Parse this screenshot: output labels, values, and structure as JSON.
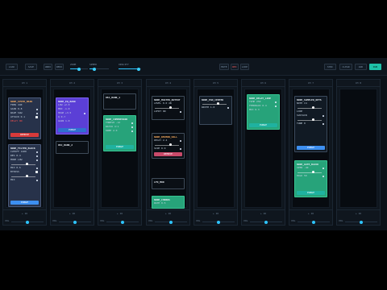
{
  "toolbar": {
    "left_buttons": [
      "LOAD",
      "SAVE",
      "UNDO",
      "REDO"
    ],
    "slider1_label": "ZOOM",
    "slider1_value": 0.5,
    "slider2_label": "SPEED",
    "slider2_value": 0.25,
    "slider3_label": "OPACITY",
    "slider3_value": 0.88,
    "mid_buttons": [
      "MUTE",
      "REC",
      "LOOP"
    ],
    "right_buttons": [
      "SYNC",
      "CLEAR",
      "ADD",
      "RUN"
    ]
  },
  "lanes": [
    {
      "head": "CH 1",
      "foot": "+ 16",
      "bottom_label": "VOL",
      "bottom_value": 0.5
    },
    {
      "head": "CH 2",
      "foot": "+ 16",
      "bottom_label": "VOL",
      "bottom_value": 0.5
    },
    {
      "head": "CH 3",
      "foot": "+ 16",
      "bottom_label": "VOL",
      "bottom_value": 0.5
    },
    {
      "head": "CH 4",
      "foot": "+ 16",
      "bottom_label": "VOL",
      "bottom_value": 0.5
    },
    {
      "head": "CH 5",
      "foot": "+ 16",
      "bottom_label": "VOL",
      "bottom_value": 0.5
    },
    {
      "head": "CH 6",
      "foot": "+ 16",
      "bottom_label": "VOL",
      "bottom_value": 0.5
    },
    {
      "head": "CH 7",
      "foot": "+ 16",
      "bottom_label": "VOL",
      "bottom_value": 0.5
    },
    {
      "head": "CH 8",
      "foot": "+ 16",
      "bottom_label": "VOL",
      "bottom_value": 0.5
    }
  ],
  "cards": {
    "c1a": {
      "title": "NODE_SYNTH_MAIN",
      "rows": [
        "FREQ  440",
        "GAIN  0.8",
        "WAVE  SAW",
        "ATTACK  0.1",
        "DELAY  ON"
      ],
      "button": "REMOVE"
    },
    "c1b": {
      "title": "NODE_FILTER_BLOCK",
      "rows": [
        "CUTOFF  1200",
        "RES  0.4",
        "MODE  LOW",
        "DRIVE",
        "MIX  0.6",
        "BYPASS",
        "DRY/WET",
        "MIX"
      ],
      "button": "PURGE"
    },
    "c2a": {
      "title": "NODE_EQ_BAND",
      "rows": [
        "LOW  +2.0",
        "MID  -1.0",
        "HIGH  +3.5",
        "Q  0.7",
        "GAIN  1.0"
      ],
      "button": "PURGE"
    },
    "c2b": {
      "title": "OSC_BANK_2"
    },
    "c3a": {
      "title": "OSC_BANK_1"
    },
    "c3b": {
      "title": "NODE_COMPRESSOR",
      "rows": [
        "THRESH  -12",
        "RATIO  4:1",
        "KNEE  2.0"
      ],
      "button": "PURGE"
    },
    "c4a": {
      "title": "NODE_MASTER_OUTPUT",
      "rows": [
        "LEVEL  0.0 dB",
        "CEILING  -0.3",
        "LIMIT  ON"
      ]
    },
    "c4b": {
      "title": "NODE_REVERB_HALL",
      "rows": [
        "DECAY  2.4",
        "PREDELAY  20",
        "SIZE  0.9"
      ],
      "button": "REMOVE"
    },
    "c4c": {
      "title": "LFO_MOD"
    },
    "c4d": {
      "title": "NODE_CHORUS",
      "rows": [
        "RATE  0.5"
      ]
    },
    "c5a": {
      "title": "NODE_PAN_CENTER",
      "rows": [
        "PAN  0",
        "WIDTH  1.0"
      ]
    },
    "c6a": {
      "title": "NODE_DELAY_LINE",
      "rows": [
        "TIME  250",
        "FEEDBACK  0.4",
        "MIX  0.3"
      ],
      "button": "PURGE"
    },
    "c7a": {
      "title": "NODE_SAMPLER_KEYS",
      "rows": [
        "NOTE  C4",
        "VEL  100",
        "LOOP",
        "SUSTAIN",
        "RELEASE  0.5",
        "TUNE  0"
      ],
      "button": "PURGE"
    },
    "c7b": {
      "title": "NODE_GATE_BLOCK",
      "rows": [
        "OPEN  -40",
        "CLOSE  -45",
        "HOLD  50"
      ],
      "button": "PURGE"
    }
  }
}
